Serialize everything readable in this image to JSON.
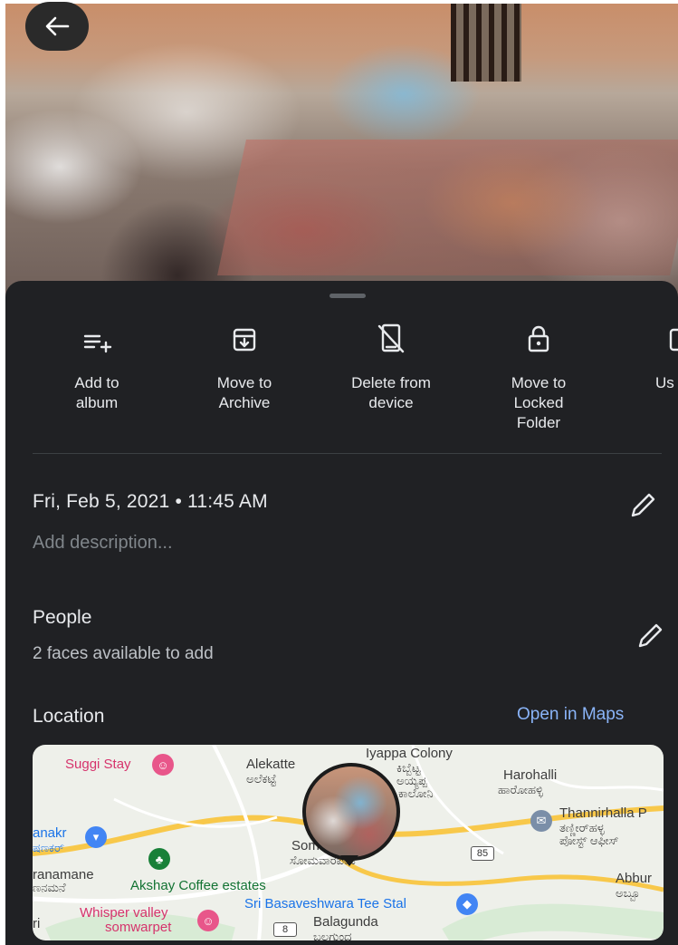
{
  "photo": {
    "description_icon": "photo-thumbnail"
  },
  "header": {
    "back_icon": "arrow-left-icon"
  },
  "actions": [
    {
      "label": "Add to\nalbum",
      "icon": "playlist-add-icon"
    },
    {
      "label": "Move to\nArchive",
      "icon": "archive-icon"
    },
    {
      "label": "Delete from\ndevice",
      "icon": "delete-device-icon"
    },
    {
      "label": "Move to\nLocked\nFolder",
      "icon": "lock-icon"
    },
    {
      "label": "Us",
      "icon": "partial-icon"
    }
  ],
  "details": {
    "date": "Fri, Feb 5, 2021 • 11:45 AM",
    "description_placeholder": "Add description..."
  },
  "people": {
    "title": "People",
    "subtitle": "2 faces available to add"
  },
  "location": {
    "title": "Location",
    "open_maps": "Open in Maps"
  },
  "map": {
    "labels": {
      "suggi": "Suggi Stay",
      "alekatte": "Alekatte",
      "alekatte_kn": "ಅಲೆಕಟ್ಟೆ",
      "iyappa": "Iyappa Colony",
      "iyappa_kn1": "ಕಿಬ್ಬೆಟ್ಟ",
      "iyappa_kn2": "ಅಯ್ಯಪ್ಪ",
      "iyappa_kn3": "ಕಾಲೋನಿ",
      "harohalli": "Harohalli",
      "harohalli_kn": "ಹಾರೋಹಳ್ಳಿ",
      "thannirhalla": "Thannirhalla P",
      "thannirhalla_kn1": "ತಣ್ಣೀರ್‌ಹಳ್ಳ",
      "thannirhalla_kn2": "ಪೋಸ್ಟ್ ಆಫೀಸ್",
      "anakr": "anakr",
      "anakr_kn": "ಷಣಕರ್",
      "somwarpet": "Somwarpet",
      "somwarpet_kn": "ಸೋಮವಾರಪೇಟೆ",
      "ranamane": "ranamane",
      "ranamane_kn": "ಣನಮನೆ",
      "akshay": "Akshay Coffee estates",
      "route85": "85",
      "abburu": "Abbur",
      "abburu_kn": "ಅಬ್ಬೂ",
      "basaveshwara": "Sri Basaveshwara Tee Stal",
      "whisper1": "Whisper valley",
      "whisper2": "somwarpet",
      "route8": "8",
      "balagunda": "Balagunda",
      "balagunda_kn": "ಬಲಗುಂದ",
      "ri": "ri"
    }
  },
  "colors": {
    "sheet": "#202124",
    "link": "#8ab4f8",
    "text": "#e8eaed",
    "muted": "#80868b"
  }
}
